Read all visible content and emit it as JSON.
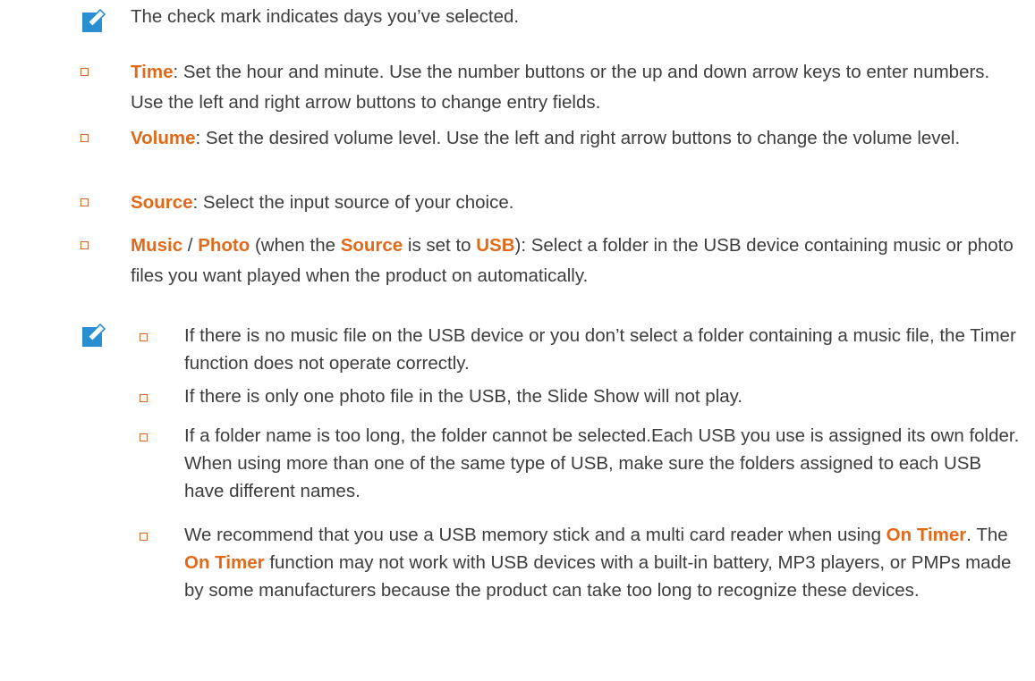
{
  "top_note": "The check mark indicates days you’ve selected.",
  "items": [
    {
      "key": "Time",
      "text": ": Set the hour and minute. Use the number buttons or the up and down arrow keys to enter numbers. Use the left and right arrow buttons to change entry fields."
    },
    {
      "key": "Volume",
      "text": ": Set the desired volume level. Use the left and right arrow buttons to change the volume level."
    },
    {
      "key": "Source",
      "text": ": Select the input source of your choice."
    },
    {
      "key": "Music",
      "sep": " / ",
      "key2": "Photo",
      "mid1": " (when the ",
      "key3": "Source",
      "mid2": " is set to ",
      "key4": "USB",
      "text": "): Select a folder in the USB device containing music or photo files you want played when the product on automatically."
    }
  ],
  "notes": [
    {
      "text": "If there is no music file on the USB device or you don’t select a folder containing a music file, the Timer function does not operate correctly."
    },
    {
      "text": "If there is only one photo file in the USB, the Slide Show will not play."
    },
    {
      "text": "If a folder name is too long, the folder cannot be selected.Each USB you use is assigned its own folder. When using more than one of the same type of USB, make sure the folders assigned to each USB have different names."
    },
    {
      "pre": "We recommend that you use a USB memory stick and a multi card reader when using ",
      "key": "On Timer",
      "mid": ". The ",
      "key2": "On Timer",
      "post": " function may not work with USB devices with a built-in battery, MP3 players, or PMPs made by some manufacturers because the product can take too long to recognize these devices."
    }
  ],
  "colors": {
    "highlight": "#e06a1a",
    "text": "#3d3d3d",
    "icon": "#2a8fd0"
  },
  "icons": [
    "note-icon"
  ]
}
